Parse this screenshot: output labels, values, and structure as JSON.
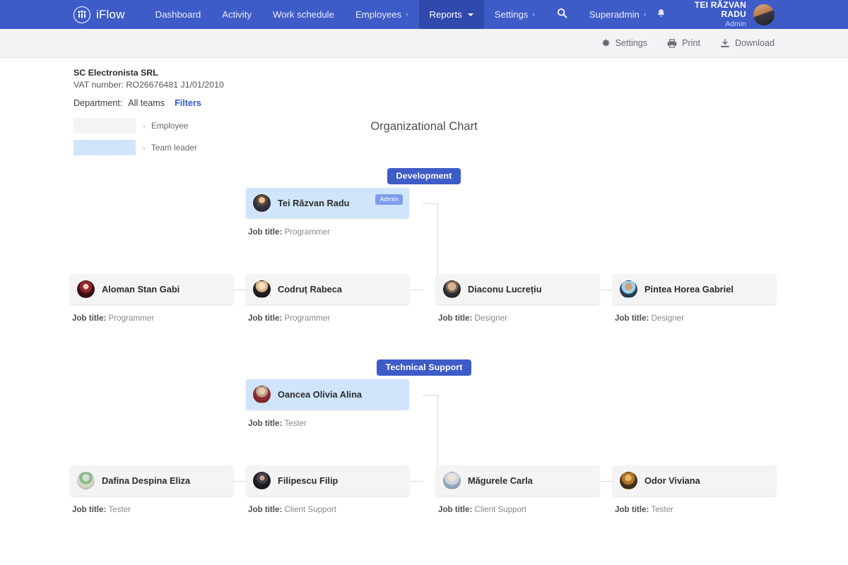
{
  "navbar": {
    "brand": "iFlow",
    "items": [
      {
        "label": "Dashboard",
        "caret": "",
        "active": false
      },
      {
        "label": "Activity",
        "caret": "",
        "active": false
      },
      {
        "label": "Work schedule",
        "caret": "",
        "active": false
      },
      {
        "label": "Employees",
        "caret": "›",
        "active": false
      },
      {
        "label": "Reports",
        "caret": "down",
        "active": true
      },
      {
        "label": "Settings",
        "caret": "›",
        "active": false
      }
    ],
    "superadmin": {
      "label": "Superadmin",
      "caret": "›"
    },
    "search_icon": "search-icon",
    "bell_icon": "bell-icon",
    "user": {
      "name": "TEI RĂZVAN RADU",
      "role": "Admin"
    },
    "bg_color": "#3e5cc7",
    "active_color": "#3049ad"
  },
  "toolbar": {
    "settings_label": "Settings",
    "print_label": "Print",
    "download_label": "Download"
  },
  "company": {
    "name": "SC Electronista SRL",
    "vat": "VAT number: RO26676481 J1/01/2010",
    "department_label": "Department:",
    "department_value": "All teams",
    "filters_label": "Filters"
  },
  "chart": {
    "title": "Organizational Chart",
    "legend": [
      {
        "label": "Employee",
        "dash": "-",
        "color": "#f4f4f5"
      },
      {
        "label": "Team leader",
        "dash": "-",
        "color": "#d0e5fb"
      }
    ],
    "job_title_prefix": "Job title:",
    "admin_badge": "Admin"
  },
  "groups": [
    {
      "department": "Development",
      "leader": {
        "name": "Tei Răzvan Radu",
        "job": "Programmer",
        "badge": "Admin",
        "type": "leader"
      },
      "members": [
        {
          "name": "Aloman Stan Gabi",
          "job": "Programmer",
          "type": "employee"
        },
        {
          "name": "Codruț Rabeca",
          "job": "Programmer",
          "type": "employee"
        },
        {
          "name": "Diaconu Lucrețiu",
          "job": "Designer",
          "type": "employee"
        },
        {
          "name": "Pintea Horea Gabriel",
          "job": "Designer",
          "type": "employee"
        }
      ]
    },
    {
      "department": "Technical Support",
      "leader": {
        "name": "Oancea Olivia Alina",
        "job": "Tester",
        "badge": "",
        "type": "leader"
      },
      "members": [
        {
          "name": "Dafina Despina Eliza",
          "job": "Tester",
          "type": "employee"
        },
        {
          "name": "Filipescu Filip",
          "job": "Client Support",
          "type": "employee"
        },
        {
          "name": "Măgurele Carla",
          "job": "Client Support",
          "type": "employee"
        },
        {
          "name": "Odor Viviana",
          "job": "Tester",
          "type": "employee"
        }
      ]
    }
  ]
}
